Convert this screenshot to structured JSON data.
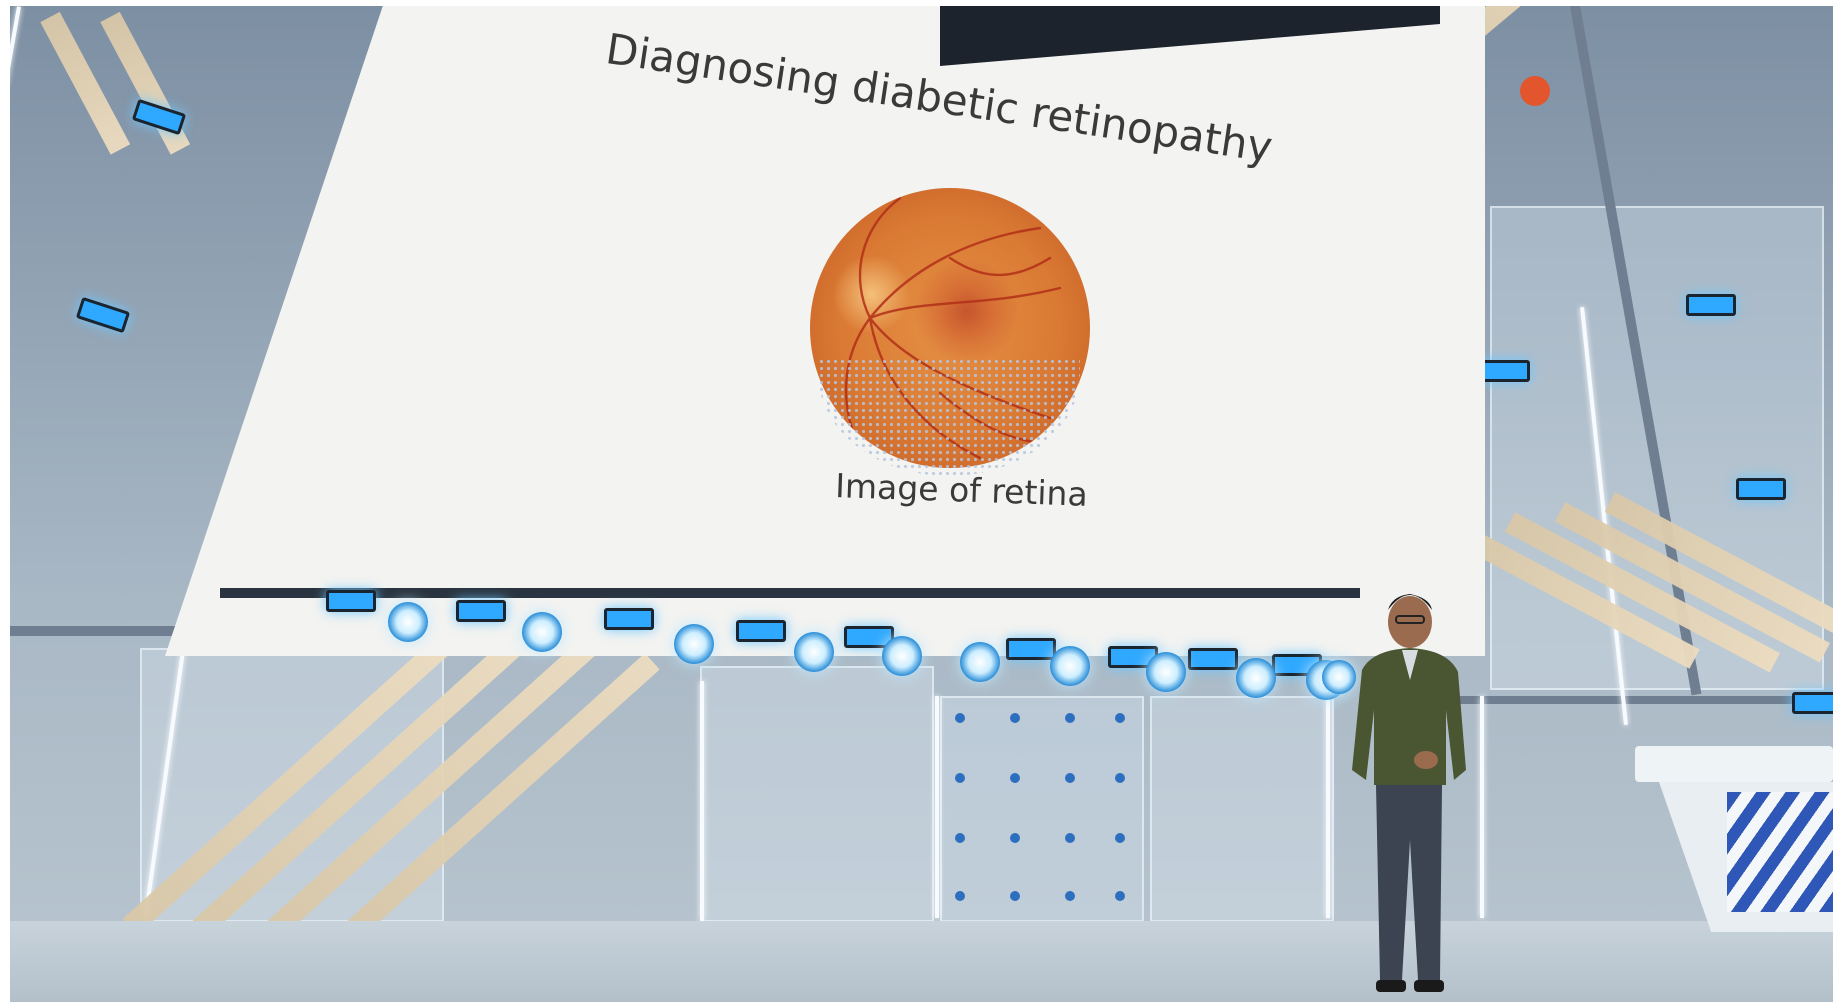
{
  "slide": {
    "title": "Diagnosing diabetic retinopathy",
    "caption": "Image of retina"
  },
  "colors": {
    "screen_background": "#f3f3f1",
    "slide_text": "#3a3a3a",
    "stage_lights": "#2fa8ff",
    "retina_orange": "#e08a3f",
    "podium_stripes": "#2f57b7",
    "speaker_jacket": "#4a5532"
  }
}
